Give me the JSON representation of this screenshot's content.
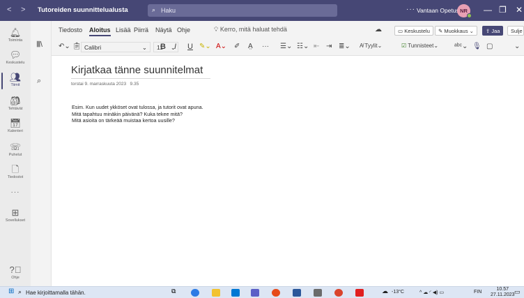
{
  "titlebar": {
    "back": "<",
    "forward": ">",
    "app_title": "Tutoreiden suunnittelualusta",
    "search_placeholder": "Haku",
    "more": "···",
    "org": "Vantaan Opetus",
    "avatar_initials": "NR",
    "minimize": "—",
    "maximize": "❐",
    "close": "✕"
  },
  "rail": {
    "items": [
      {
        "icon": "bell-icon",
        "label": "Toiminta"
      },
      {
        "icon": "chat-icon",
        "label": "Keskustelu"
      },
      {
        "icon": "teams-icon",
        "label": "Tiimit"
      },
      {
        "icon": "assignments-icon",
        "label": "Tehtävät"
      },
      {
        "icon": "calendar-icon",
        "label": "Kalenteri"
      },
      {
        "icon": "phone-icon",
        "label": "Puhelut"
      },
      {
        "icon": "files-icon",
        "label": "Tiedostot"
      },
      {
        "icon": "apps-icon",
        "label": "Sovellukset"
      },
      {
        "icon": "help-icon",
        "label": "Ohje"
      }
    ],
    "more": "···"
  },
  "menubar": {
    "tabs": [
      "Tiedosto",
      "Aloitus",
      "Lisää",
      "Piirrä",
      "Näytä",
      "Ohje"
    ],
    "active_tab": "Aloitus",
    "tell_me": "Kerro, mitä haluat tehdä",
    "chat_button": "Keskustelu",
    "edit_button": "Muokkaus",
    "share_button": "Jaa",
    "close_button": "Sulje"
  },
  "ribbon": {
    "font_name": "Calibri",
    "font_size": "11",
    "bold": "B",
    "italic": "I",
    "underline": "U",
    "more": "···",
    "styles": "Tyylit",
    "tags": "Tunnisteet"
  },
  "page": {
    "title": "Kirjatkaa tänne suunnitelmat",
    "date": "torstai 9. marraskuuta 2023",
    "time": "9.35",
    "lines": [
      "Esim. Kun uudet ykköset ovat tulossa, ja tutorit ovat apuna.",
      "Mitä tapahtuu minäkin päivänä? Kuka tekee mitä?",
      "Mitä asioita on tärkeää muistaa kertoa uusille?"
    ]
  },
  "taskbar": {
    "search_placeholder": "Hae kirjoittamalla tähän.",
    "temperature": "-13°C",
    "language": "FIN",
    "clock_time": "10.57",
    "clock_date": "27.11.2023"
  },
  "colors": {
    "teams_purple": "#464775",
    "accent_green": "#92c353"
  }
}
